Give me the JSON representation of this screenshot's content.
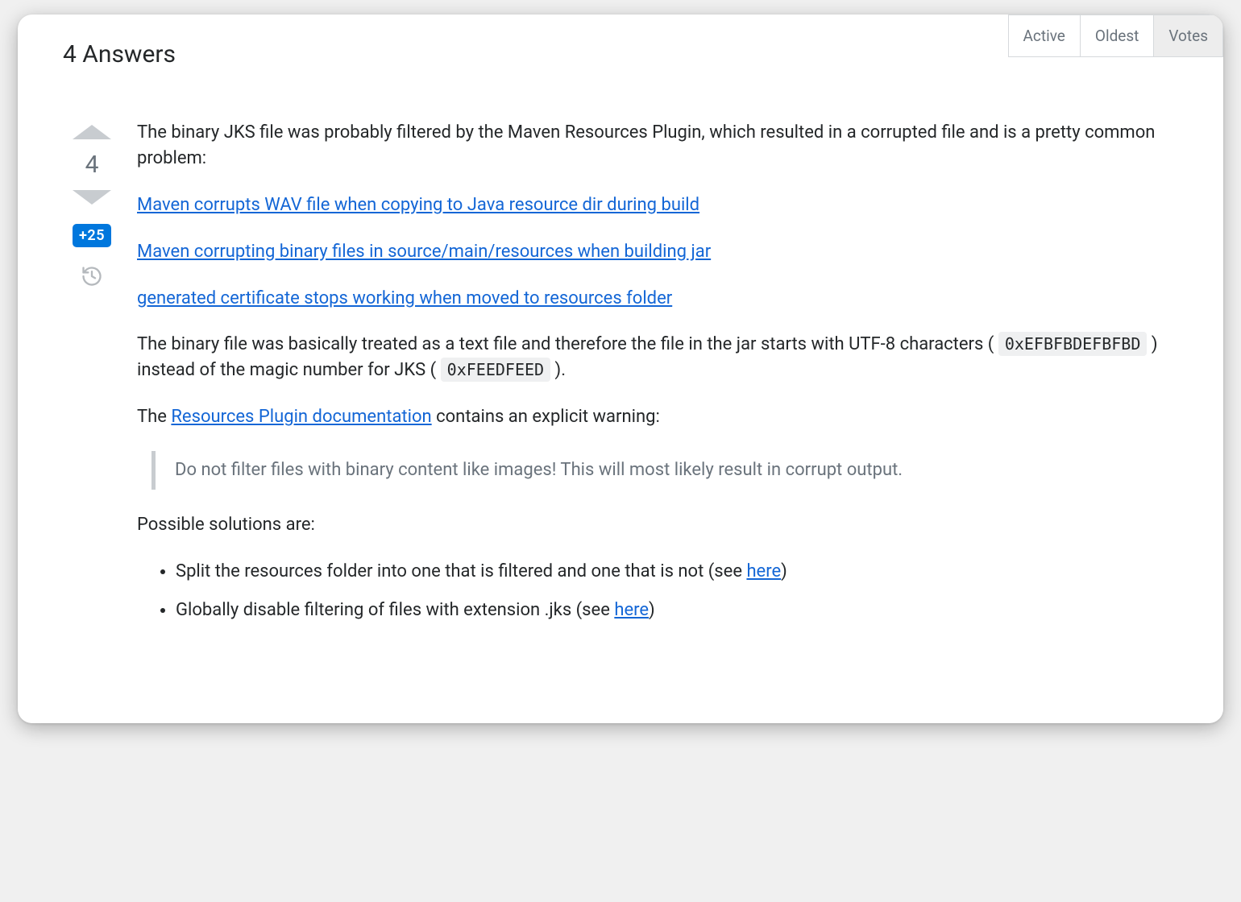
{
  "header": {
    "title": "4 Answers"
  },
  "sort": {
    "tabs": [
      "Active",
      "Oldest",
      "Votes"
    ],
    "active_index": 2
  },
  "vote": {
    "count": "4",
    "bounty": "+25"
  },
  "post": {
    "intro": "The binary JKS file was probably filtered by the Maven Resources Plugin, which resulted in a corrupted file and is a pretty common problem:",
    "links": [
      "Maven corrupts WAV file when copying to Java resource dir during build",
      "Maven corrupting binary files in source/main/resources when building jar",
      "generated certificate stops working when moved to resources folder"
    ],
    "explain_pre": "The binary file was basically treated as a text file and therefore the file in the jar starts with UTF-8 characters (",
    "code1": "0xEFBFBDEFBFBD",
    "explain_mid": ") instead of the magic number for JKS (",
    "code2": "0xFEEDFEED",
    "explain_post": ").",
    "doc_pre": "The ",
    "doc_link": "Resources Plugin documentation",
    "doc_post": " contains an explicit warning:",
    "warning_quote": "Do not filter files with binary content like images! This will most likely result in corrupt output.",
    "solutions_label": "Possible solutions are:",
    "solutions": [
      {
        "text_pre": "Split the resources folder into one that is filtered and one that is not (see ",
        "link": "here",
        "text_post": ")"
      },
      {
        "text_pre": "Globally disable filtering of files with extension .jks (see ",
        "link": "here",
        "text_post": ")"
      }
    ]
  }
}
